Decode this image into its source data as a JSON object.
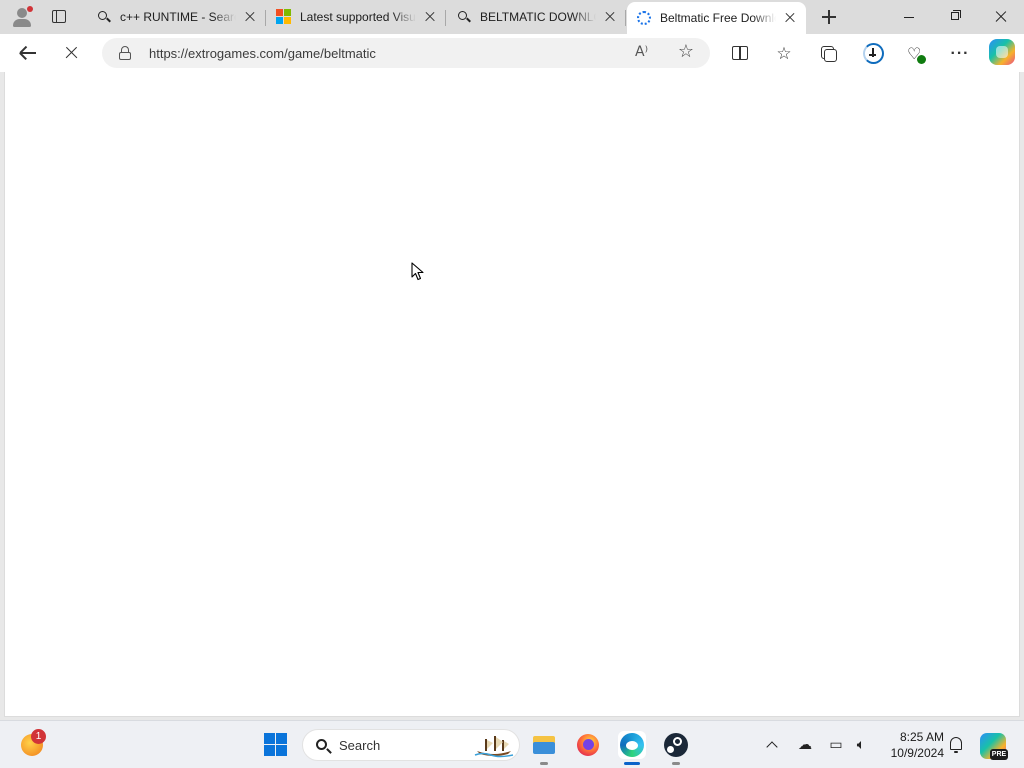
{
  "tabs": [
    {
      "title": "c++ RUNTIME - Search",
      "favicon": "search-icon",
      "active": false
    },
    {
      "title": "Latest supported Visual C++ Redistributable",
      "favicon": "microsoft-logo-icon",
      "active": false
    },
    {
      "title": "BELTMATIC DOWNLOAD",
      "favicon": "search-icon",
      "active": false
    },
    {
      "title": "Beltmatic Free Download",
      "favicon": "loading-spinner-icon",
      "active": true
    }
  ],
  "address_bar": {
    "url": "https://extrogames.com/game/beltmatic",
    "read_aloud_glyph": "A⁾"
  },
  "page": {
    "state": "loading",
    "body": ""
  },
  "taskbar": {
    "weather_badge": "1",
    "search_label": "Search",
    "apps": [
      "file-explorer-icon",
      "firefox-icon",
      "edge-icon",
      "steam-icon"
    ],
    "active_app": "edge-icon",
    "clock_time": "8:25 AM",
    "clock_date": "10/9/2024",
    "copilot_badge": "PRE"
  },
  "colors": {
    "accent": "#0a63c9",
    "tabstrip": "#dcdcdc",
    "taskbar": "#eef0f4"
  }
}
